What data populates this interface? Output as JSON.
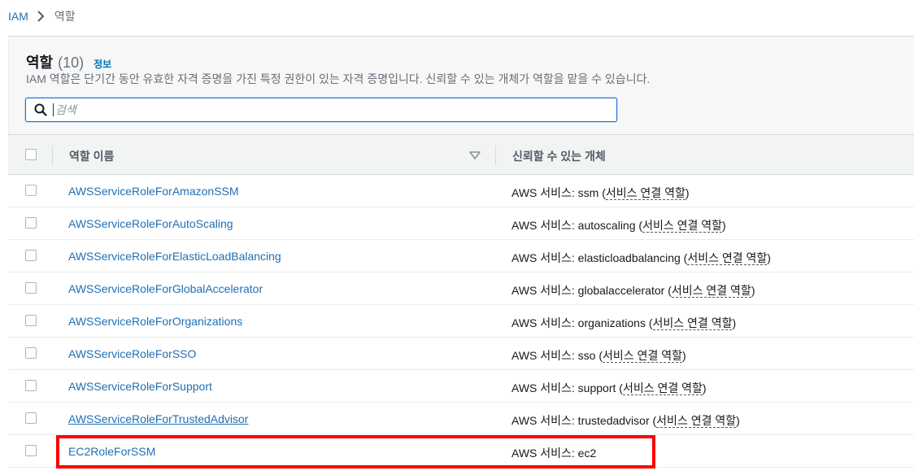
{
  "breadcrumb": {
    "root": "IAM",
    "current": "역할"
  },
  "panel": {
    "title": "역할",
    "count": "(10)",
    "info": "정보",
    "description": "IAM 역할은 단기간 동안 유효한 자격 증명을 가진 특정 권한이 있는 자격 증명입니다. 신뢰할 수 있는 개체가 역할을 맡을 수 있습니다."
  },
  "search": {
    "placeholder": "검색",
    "value": ""
  },
  "table": {
    "columns": [
      "역할 이름",
      "신뢰할 수 있는 개체"
    ],
    "service_link_label": "서비스 연결 역할",
    "rows": [
      {
        "name": "AWSServiceRoleForAmazonSSM",
        "trust_prefix": "AWS 서비스: ssm (",
        "trust_link": "서비스 연결 역할",
        "trust_suffix": ")"
      },
      {
        "name": "AWSServiceRoleForAutoScaling",
        "trust_prefix": "AWS 서비스: autoscaling (",
        "trust_link": "서비스 연결 역할",
        "trust_suffix": ")"
      },
      {
        "name": "AWSServiceRoleForElasticLoadBalancing",
        "trust_prefix": "AWS 서비스: elasticloadbalancing (",
        "trust_link": "서비스 연결 역할",
        "trust_suffix": ")"
      },
      {
        "name": "AWSServiceRoleForGlobalAccelerator",
        "trust_prefix": "AWS 서비스: globalaccelerator (",
        "trust_link": "서비스 연결 역할",
        "trust_suffix": ")"
      },
      {
        "name": "AWSServiceRoleForOrganizations",
        "trust_prefix": "AWS 서비스: organizations (",
        "trust_link": "서비스 연결 역할",
        "trust_suffix": ")"
      },
      {
        "name": "AWSServiceRoleForSSO",
        "trust_prefix": "AWS 서비스: sso (",
        "trust_link": "서비스 연결 역할",
        "trust_suffix": ")"
      },
      {
        "name": "AWSServiceRoleForSupport",
        "trust_prefix": "AWS 서비스: support (",
        "trust_link": "서비스 연결 역할",
        "trust_suffix": ")"
      },
      {
        "name": "AWSServiceRoleForTrustedAdvisor",
        "trust_prefix": "AWS 서비스: trustedadvisor (",
        "trust_link": "서비스 연결 역할",
        "trust_suffix": ")"
      },
      {
        "name": "EC2RoleForSSM",
        "trust_prefix": "AWS 서비스: ec2",
        "trust_link": "",
        "trust_suffix": ""
      }
    ]
  },
  "colors": {
    "link": "#1f6fb5",
    "highlight": "#ff0000",
    "header_bg": "#f7f7f7"
  }
}
